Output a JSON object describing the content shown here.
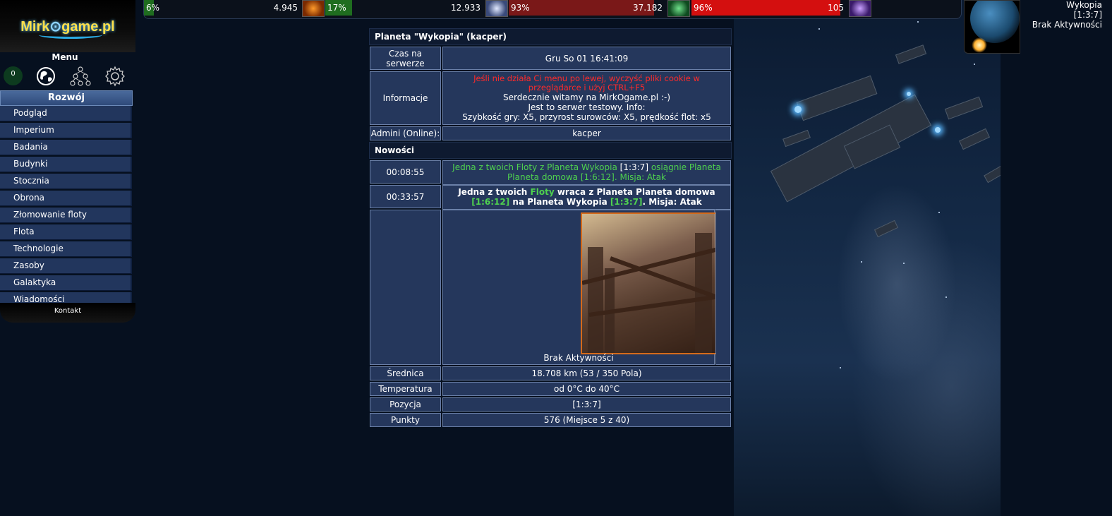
{
  "logo": {
    "text_a": "Mirk",
    "text_b": "game.pl"
  },
  "sidebar": {
    "menu_title": "Menu",
    "badge_count": "0",
    "section_title": "Rozwój",
    "items": [
      {
        "label": "Podgląd"
      },
      {
        "label": "Imperium"
      },
      {
        "label": "Badania"
      },
      {
        "label": "Budynki"
      },
      {
        "label": "Stocznia"
      },
      {
        "label": "Obrona"
      },
      {
        "label": "Złomowanie floty"
      },
      {
        "label": "Flota"
      },
      {
        "label": "Technologie"
      },
      {
        "label": "Zasoby"
      },
      {
        "label": "Galaktyka"
      },
      {
        "label": "Wiadomości"
      }
    ],
    "contact": "Kontakt"
  },
  "resources": [
    {
      "percent": "6%",
      "value": "4.945",
      "fill": 0.06,
      "color": "#1f6d1f"
    },
    {
      "percent": "17%",
      "value": "12.933",
      "fill": 0.17,
      "color": "#1f6d1f"
    },
    {
      "percent": "93%",
      "value": "37.182",
      "fill": 0.93,
      "color": "#7a1818"
    },
    {
      "percent": "96%",
      "value": "105",
      "fill": 0.96,
      "color": "#d40f0f"
    }
  ],
  "planet_info": {
    "name": "Wykopia",
    "coords": "[1:3:7]",
    "activity": "Brak Aktywności"
  },
  "overview": {
    "title": "Planeta \"Wykopia\" (kacper)",
    "server_time_label": "Czas na serwerze",
    "server_time": "Gru So 01 16:41:09",
    "info_label": "Informacje",
    "info_warning": "Jeśli nie działa Ci menu po lewej, wyczyść pliki cookie w przeglądarce i użyj CTRL+F5",
    "info_line1": "Serdecznie witamy na MirkOgame.pl :-)",
    "info_line2": "Jest to serwer testowy. Info:",
    "info_line3": "Szybkość gry: X5, przyrost surowców: X5, prędkość flot: x5",
    "admins_label": "Admini (Online):",
    "admins": "kacper",
    "news_title": "Nowości",
    "events": [
      {
        "time": "00:08:55",
        "p1": "Jedna z twoich Floty z Planeta Wykopia ",
        "p2": "[1:3:7]",
        "p3": " osiągnie Planeta Planeta domowa ",
        "p4": "[1:6:12]",
        "p5": ". Misja: Atak"
      },
      {
        "time": "00:33:57",
        "p1": "Jedna z twoich ",
        "p2": "Floty",
        "p3": " wraca z Planeta Planeta domowa ",
        "p4": "[1:6:12]",
        "p5": " na Planeta Wykopia ",
        "p6": "[1:3:7]",
        "p7": ". Misja: Atak"
      }
    ],
    "image_caption": "Brak Aktywności",
    "diameter_label": "Średnica",
    "diameter": "18.708 km (53 / 350 Pola)",
    "temperature_label": "Temperatura",
    "temperature": "od 0°C do 40°C",
    "position_label": "Pozycja",
    "position": "[1:3:7]",
    "points_label": "Punkty",
    "points": "576 (Miejsce 5 z 40)"
  }
}
